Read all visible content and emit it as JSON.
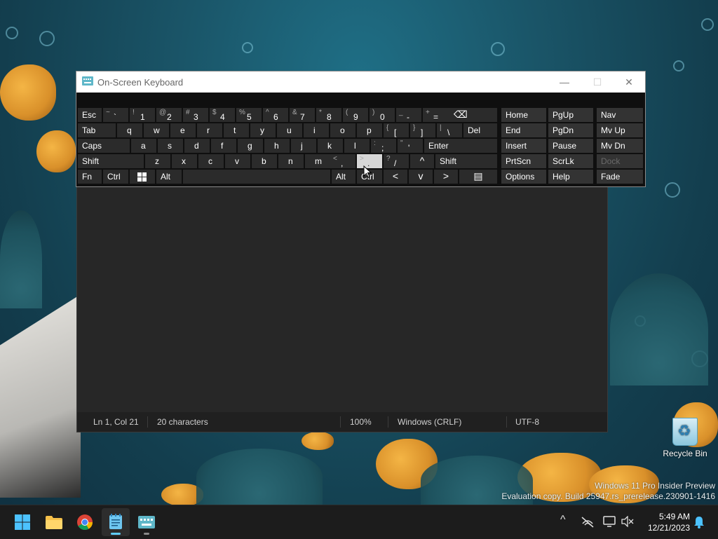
{
  "desktop": {
    "watermark_line1": "Windows 11 Pro Insider Preview",
    "watermark_line2": "Evaluation copy. Build 25947.rs_prerelease.230901-1416",
    "recycle_bin_label": "Recycle Bin"
  },
  "osk": {
    "title": "On-Screen Keyboard",
    "controls": {
      "minimize": "—",
      "maximize": "☐",
      "close": "✕"
    },
    "row1": [
      {
        "sh": "~",
        "mn": "`"
      },
      {
        "sh": "!",
        "mn": "1"
      },
      {
        "sh": "@",
        "mn": "2"
      },
      {
        "sh": "#",
        "mn": "3"
      },
      {
        "sh": "$",
        "mn": "4"
      },
      {
        "sh": "%",
        "mn": "5"
      },
      {
        "sh": "^",
        "mn": "6"
      },
      {
        "sh": "&",
        "mn": "7"
      },
      {
        "sh": "*",
        "mn": "8"
      },
      {
        "sh": "(",
        "mn": "9"
      },
      {
        "sh": ")",
        "mn": "0"
      },
      {
        "sh": "_",
        "mn": "-"
      },
      {
        "sh": "+",
        "mn": "="
      }
    ],
    "esc": "Esc",
    "backspace": "⌫",
    "tab": "Tab",
    "row2_letters": [
      "q",
      "w",
      "e",
      "r",
      "t",
      "y",
      "u",
      "i",
      "o",
      "p"
    ],
    "row2_sym": [
      {
        "sh": "{",
        "mn": "["
      },
      {
        "sh": "}",
        "mn": "]"
      },
      {
        "sh": "|",
        "mn": "\\"
      }
    ],
    "del": "Del",
    "caps": "Caps",
    "row3_letters": [
      "a",
      "s",
      "d",
      "f",
      "g",
      "h",
      "j",
      "k",
      "l"
    ],
    "row3_sym": [
      {
        "sh": ":",
        "mn": ";"
      },
      {
        "sh": "\"",
        "mn": "'"
      }
    ],
    "enter": "Enter",
    "shift": "Shift",
    "row4_letters": [
      "z",
      "x",
      "c",
      "v",
      "b",
      "n",
      "m"
    ],
    "row4_sym": [
      {
        "sh": "<",
        "mn": ","
      },
      {
        "sh": ">",
        "mn": "."
      },
      {
        "sh": "?",
        "mn": "/"
      }
    ],
    "up": "^",
    "fn": "Fn",
    "ctrl": "Ctrl",
    "alt": "Alt",
    "left": "<",
    "down": "v",
    "right": ">",
    "menu": "▤",
    "nav_keys": {
      "home": "Home",
      "pgup": "PgUp",
      "nav": "Nav",
      "end": "End",
      "pgdn": "PgDn",
      "mvup": "Mv Up",
      "insert": "Insert",
      "pause": "Pause",
      "mvdn": "Mv Dn",
      "prtscn": "PrtScn",
      "scrlk": "ScrLk",
      "dock": "Dock",
      "options": "Options",
      "help": "Help",
      "fade": "Fade"
    }
  },
  "notepad": {
    "status": {
      "position": "Ln 1, Col 21",
      "characters": "20 characters",
      "zoom": "100%",
      "line_ending": "Windows (CRLF)",
      "encoding": "UTF-8"
    }
  },
  "taskbar": {
    "time": "5:49 AM",
    "date": "12/21/2023",
    "tray_overflow": "^"
  }
}
